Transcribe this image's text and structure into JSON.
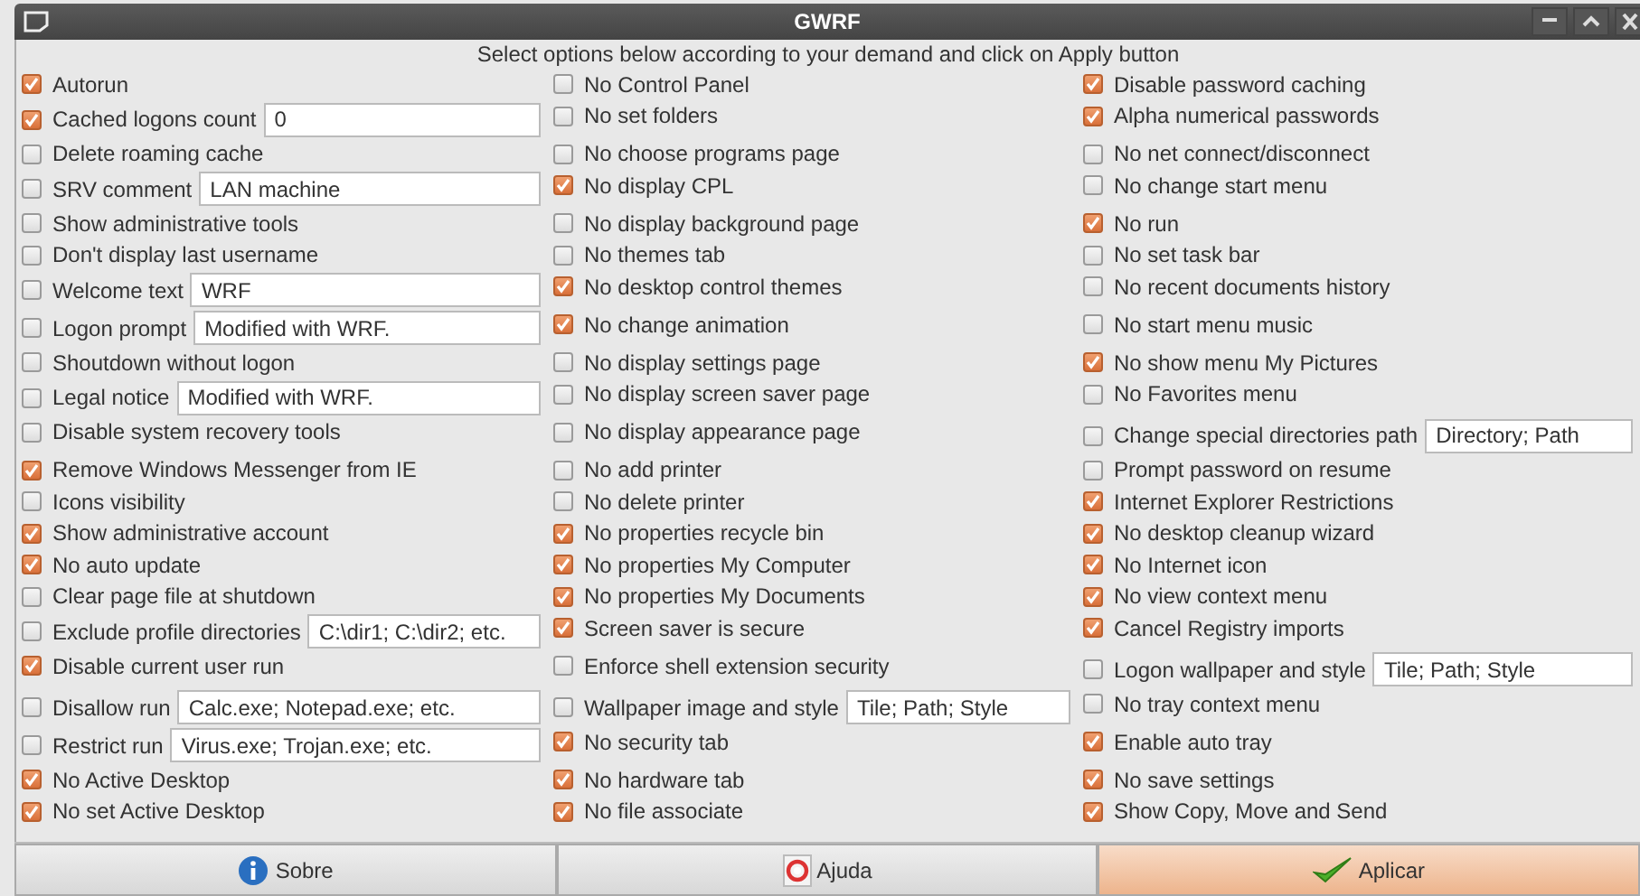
{
  "window": {
    "title": "GWRF"
  },
  "instruction": "Select options below according to your demand and click on Apply button",
  "columns": [
    [
      {
        "label": "Autorun",
        "checked": true
      },
      {
        "label": "Cached logons count",
        "checked": true,
        "value": "0"
      },
      {
        "label": "Delete roaming cache",
        "checked": false
      },
      {
        "label": "SRV comment",
        "checked": false,
        "value": "LAN machine"
      },
      {
        "label": "Show administrative tools",
        "checked": false
      },
      {
        "label": "Don't display last username",
        "checked": false
      },
      {
        "label": "Welcome text",
        "checked": false,
        "value": "WRF"
      },
      {
        "label": "Logon prompt",
        "checked": false,
        "value": "Modified with WRF."
      },
      {
        "label": "Shoutdown without logon",
        "checked": false
      },
      {
        "label": "Legal notice",
        "checked": false,
        "value": "Modified with WRF."
      },
      {
        "label": "Disable system recovery tools",
        "checked": false
      },
      {
        "label": "Remove Windows Messenger from IE",
        "checked": true
      },
      {
        "label": "Icons visibility",
        "checked": false
      },
      {
        "label": "Show administrative account",
        "checked": true
      },
      {
        "label": "No auto update",
        "checked": true
      },
      {
        "label": "Clear page file at shutdown",
        "checked": false
      },
      {
        "label": "Exclude profile directories",
        "checked": false,
        "value": "C:\\dir1; C:\\dir2; etc."
      },
      {
        "label": "Disable current user run",
        "checked": true
      },
      {
        "label": "Disallow run",
        "checked": false,
        "value": "Calc.exe; Notepad.exe; etc."
      },
      {
        "label": "Restrict run",
        "checked": false,
        "value": "Virus.exe; Trojan.exe; etc."
      },
      {
        "label": "No Active Desktop",
        "checked": true
      },
      {
        "label": "No set Active Desktop",
        "checked": true
      }
    ],
    [
      {
        "label": "No Control Panel",
        "checked": false
      },
      {
        "label": "No set folders",
        "checked": false
      },
      {
        "label": "No choose programs page",
        "checked": false
      },
      {
        "label": "No display CPL",
        "checked": true
      },
      {
        "label": "No display background page",
        "checked": false
      },
      {
        "label": "No themes tab",
        "checked": false
      },
      {
        "label": "No desktop control themes",
        "checked": true
      },
      {
        "label": "No change animation",
        "checked": true
      },
      {
        "label": "No display settings page",
        "checked": false
      },
      {
        "label": "No display screen saver page",
        "checked": false
      },
      {
        "label": "No display appearance page",
        "checked": false
      },
      {
        "label": "No add printer",
        "checked": false
      },
      {
        "label": "No delete printer",
        "checked": false
      },
      {
        "label": "No properties recycle bin",
        "checked": true
      },
      {
        "label": "No properties My Computer",
        "checked": true
      },
      {
        "label": "No properties My Documents",
        "checked": true
      },
      {
        "label": "Screen saver is secure",
        "checked": true
      },
      {
        "label": "Enforce shell extension security",
        "checked": false
      },
      {
        "label": "Wallpaper image and style",
        "checked": false,
        "value": "Tile; Path; Style"
      },
      {
        "label": "No security tab",
        "checked": true
      },
      {
        "label": "No hardware tab",
        "checked": true
      },
      {
        "label": "No file associate",
        "checked": true
      }
    ],
    [
      {
        "label": "Disable password caching",
        "checked": true
      },
      {
        "label": "Alpha numerical passwords",
        "checked": true
      },
      {
        "label": "No net connect/disconnect",
        "checked": false
      },
      {
        "label": "No change start menu",
        "checked": false
      },
      {
        "label": "No run",
        "checked": true
      },
      {
        "label": "No set task bar",
        "checked": false
      },
      {
        "label": "No recent documents history",
        "checked": false
      },
      {
        "label": "No start menu music",
        "checked": false
      },
      {
        "label": "No show menu My Pictures",
        "checked": true
      },
      {
        "label": "No Favorites menu",
        "checked": false
      },
      {
        "label": "Change special directories path",
        "checked": false,
        "value": "Directory; Path"
      },
      {
        "label": "Prompt password on resume",
        "checked": false
      },
      {
        "label": "Internet Explorer Restrictions",
        "checked": true
      },
      {
        "label": "No desktop cleanup wizard",
        "checked": true
      },
      {
        "label": "No Internet icon",
        "checked": true
      },
      {
        "label": "No view context menu",
        "checked": true
      },
      {
        "label": "Cancel Registry imports",
        "checked": true
      },
      {
        "label": "Logon wallpaper and style",
        "checked": false,
        "value": "Tile; Path; Style"
      },
      {
        "label": "No tray context menu",
        "checked": false
      },
      {
        "label": "Enable auto tray",
        "checked": true
      },
      {
        "label": "No save settings",
        "checked": true
      },
      {
        "label": "Show Copy, Move and Send",
        "checked": true
      }
    ]
  ],
  "buttons": [
    {
      "kind": "info",
      "label": "Sobre"
    },
    {
      "kind": "help",
      "label": "Ajuda"
    },
    {
      "kind": "apply",
      "label": "Aplicar"
    }
  ]
}
